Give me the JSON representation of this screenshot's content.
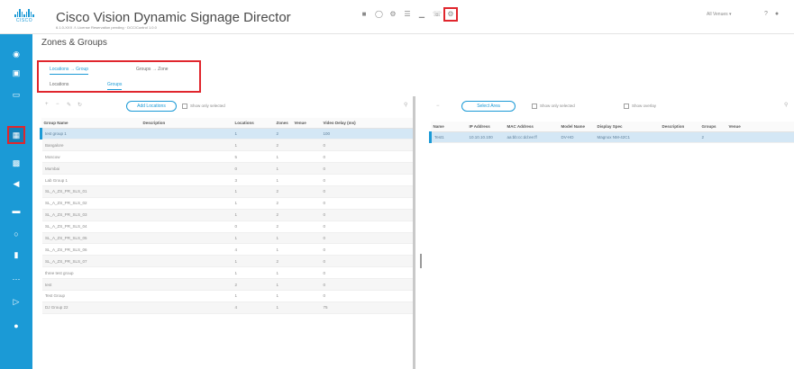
{
  "app": {
    "title": "Cisco Vision Dynamic Signage Director",
    "subtitle": "6.1.0-XXX  ⚠ License Reservation pending  ·  DCC/Control 1.0.0",
    "logo_text": "CISCO",
    "header_right": "All Venues",
    "accent": "#1b9ad6",
    "highlight": "#e0262d"
  },
  "header_icons": [
    "folder-icon",
    "monitor-icon",
    "gear-icon",
    "list-icon",
    "chart-icon",
    "phone-icon",
    "settings-gear-icon"
  ],
  "header_right_icons": [
    "help-icon",
    "user-icon"
  ],
  "nav_icons": [
    "location-icon",
    "display-icon",
    "monitor-icon",
    "device-icon",
    "calendar-icon",
    "speaker-icon",
    "card-icon",
    "circle-icon",
    "phone-icon",
    "dots-icon",
    "export-icon",
    "circle-filled-icon"
  ],
  "page": {
    "title": "Zones & Groups",
    "tabs_top": [
      "Locations → Group",
      "Groups → Zone"
    ],
    "tabs_sub": [
      "Locations",
      "Groups"
    ]
  },
  "left_toolbar": {
    "icons": [
      "add-icon",
      "remove-icon",
      "edit-icon",
      "refresh-icon"
    ],
    "add_button": "Add Locations",
    "checkbox_label": "Show only selected",
    "search_icon": "search-icon"
  },
  "left_table": {
    "columns": [
      "Group Name",
      "Description",
      "Locations",
      "Zones",
      "Venue",
      "Video Delay (ms)"
    ],
    "rows": [
      [
        "test group 1",
        "",
        "1",
        "2",
        "",
        "100"
      ],
      [
        "Bangalore",
        "",
        "1",
        "2",
        "",
        "0"
      ],
      [
        "Moscow",
        "",
        "5",
        "1",
        "",
        "0"
      ],
      [
        "Mumbai",
        "",
        "0",
        "1",
        "",
        "0"
      ],
      [
        "Lab Group 1",
        "",
        "3",
        "1",
        "",
        "0"
      ],
      [
        "SL_A_ZS_PR_SLS_01",
        "",
        "1",
        "2",
        "",
        "0"
      ],
      [
        "SL_A_ZS_PR_SLS_02",
        "",
        "1",
        "2",
        "",
        "0"
      ],
      [
        "SL_A_ZS_PR_SLS_03",
        "",
        "1",
        "2",
        "",
        "0"
      ],
      [
        "SL_A_ZS_PR_SLS_04",
        "",
        "0",
        "2",
        "",
        "0"
      ],
      [
        "SL_A_ZS_PR_SLS_05",
        "",
        "1",
        "1",
        "",
        "0"
      ],
      [
        "SL_A_ZS_PR_SLS_06",
        "",
        "4",
        "1",
        "",
        "0"
      ],
      [
        "SL_A_ZS_PR_SLS_07",
        "",
        "1",
        "2",
        "",
        "0"
      ],
      [
        "three test group",
        "",
        "1",
        "1",
        "",
        "0"
      ],
      [
        "test",
        "",
        "2",
        "1",
        "",
        "0"
      ],
      [
        "Test Group",
        "",
        "1",
        "1",
        "",
        "0"
      ],
      [
        "DJ Group 22",
        "",
        "4",
        "1",
        "",
        "75"
      ]
    ]
  },
  "right_toolbar": {
    "remove_icon": "remove-icon",
    "button": "Select Area",
    "checkbox1": "Show only selected",
    "checkbox2": "Show overlay",
    "search_icon": "search-icon"
  },
  "right_table": {
    "columns": [
      "Name",
      "IP Address",
      "MAC Address",
      "Model Name",
      "Display Spec",
      "Description",
      "Groups",
      "Venue"
    ],
    "rows": [
      [
        "Test1",
        "10.10.10.100",
        "aa:bb:cc:dd:ee:ff",
        "DV-HD",
        "Magnox NM-42C1",
        "",
        "2",
        ""
      ]
    ]
  }
}
